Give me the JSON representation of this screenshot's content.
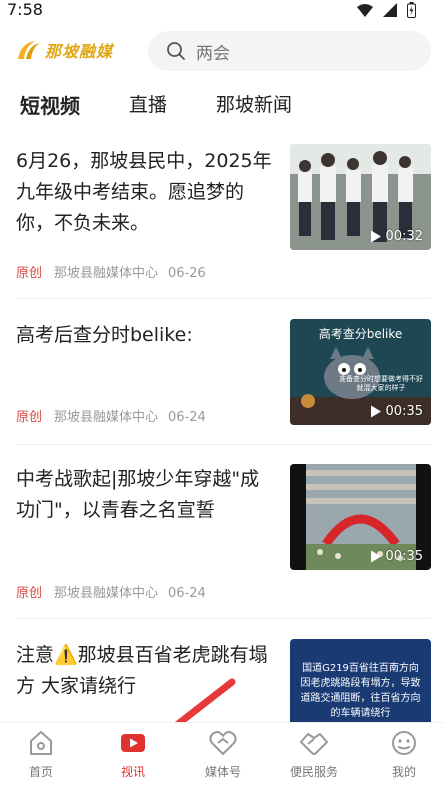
{
  "status": {
    "time": "7:58"
  },
  "header": {
    "logo_text": "那坡融媒",
    "search_placeholder": "两会"
  },
  "tabs": [
    {
      "label": "短视频"
    },
    {
      "label": "直播"
    },
    {
      "label": "那坡新闻"
    }
  ],
  "feed": [
    {
      "title": "6月26，那坡县民中，2025年九年级中考结束。愿追梦的你，不负未来。",
      "tag": "原创",
      "source": "那坡县融媒体中心",
      "date": "06-26",
      "duration": "00:32"
    },
    {
      "title": "高考后查分时belike:",
      "tag": "原创",
      "source": "那坡县融媒体中心",
      "date": "06-24",
      "duration": "00:35",
      "thumb_caption": "高考查分belike",
      "thumb_subtitle": "准备查分时想要做考得不好就混大家的样子"
    },
    {
      "title": "中考战歌起|那坡少年穿越\"成功门\"，以青春之名宣誓",
      "tag": "原创",
      "source": "那坡县融媒体中心",
      "date": "06-24",
      "duration": "00:35"
    },
    {
      "title": "注意⚠️那坡县百省老虎跳有塌方 大家请绕行",
      "thumb_caption": "国道G219百省往百南方向因老虎跳路段有塌方，导致道路交通阻断，往百省方向的车辆请绕行"
    }
  ],
  "bottom_nav": [
    {
      "label": "首页",
      "icon": "home-icon"
    },
    {
      "label": "视讯",
      "icon": "video-icon",
      "active": true
    },
    {
      "label": "媒体号",
      "icon": "media-account-icon"
    },
    {
      "label": "便民服务",
      "icon": "handshake-icon"
    },
    {
      "label": "我的",
      "icon": "profile-icon"
    }
  ],
  "colors": {
    "accent": "#e0322e",
    "tag": "#d9483f",
    "logo": "#e0a814"
  }
}
